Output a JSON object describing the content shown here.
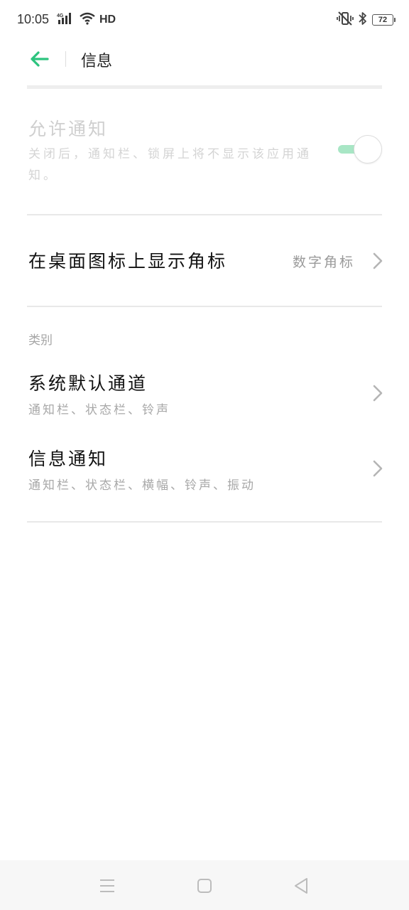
{
  "status_bar": {
    "time": "10:05",
    "network": "4G",
    "hd": "HD",
    "battery": "72",
    "icons": [
      "signal-icon",
      "wifi-icon",
      "vibrate-icon",
      "bluetooth-icon",
      "battery-icon"
    ]
  },
  "header": {
    "title": "信息",
    "back_icon": "back-arrow-icon"
  },
  "allow_notification": {
    "title": "允许通知",
    "description": "关闭后，通知栏、锁屏上将不显示该应用通知。",
    "enabled": true
  },
  "badge": {
    "label": "在桌面图标上显示角标",
    "value": "数字角标"
  },
  "category": {
    "header": "类别",
    "items": [
      {
        "title": "系统默认通道",
        "subtitle": "通知栏、状态栏、铃声"
      },
      {
        "title": "信息通知",
        "subtitle": "通知栏、状态栏、横幅、铃声、振动"
      }
    ]
  },
  "nav_bar": {
    "icons": [
      "menu-icon",
      "home-icon",
      "back-icon"
    ]
  },
  "colors": {
    "accent": "#2cc37e",
    "toggle_track": "#a8e6c5",
    "divider": "#e8e8e8"
  }
}
